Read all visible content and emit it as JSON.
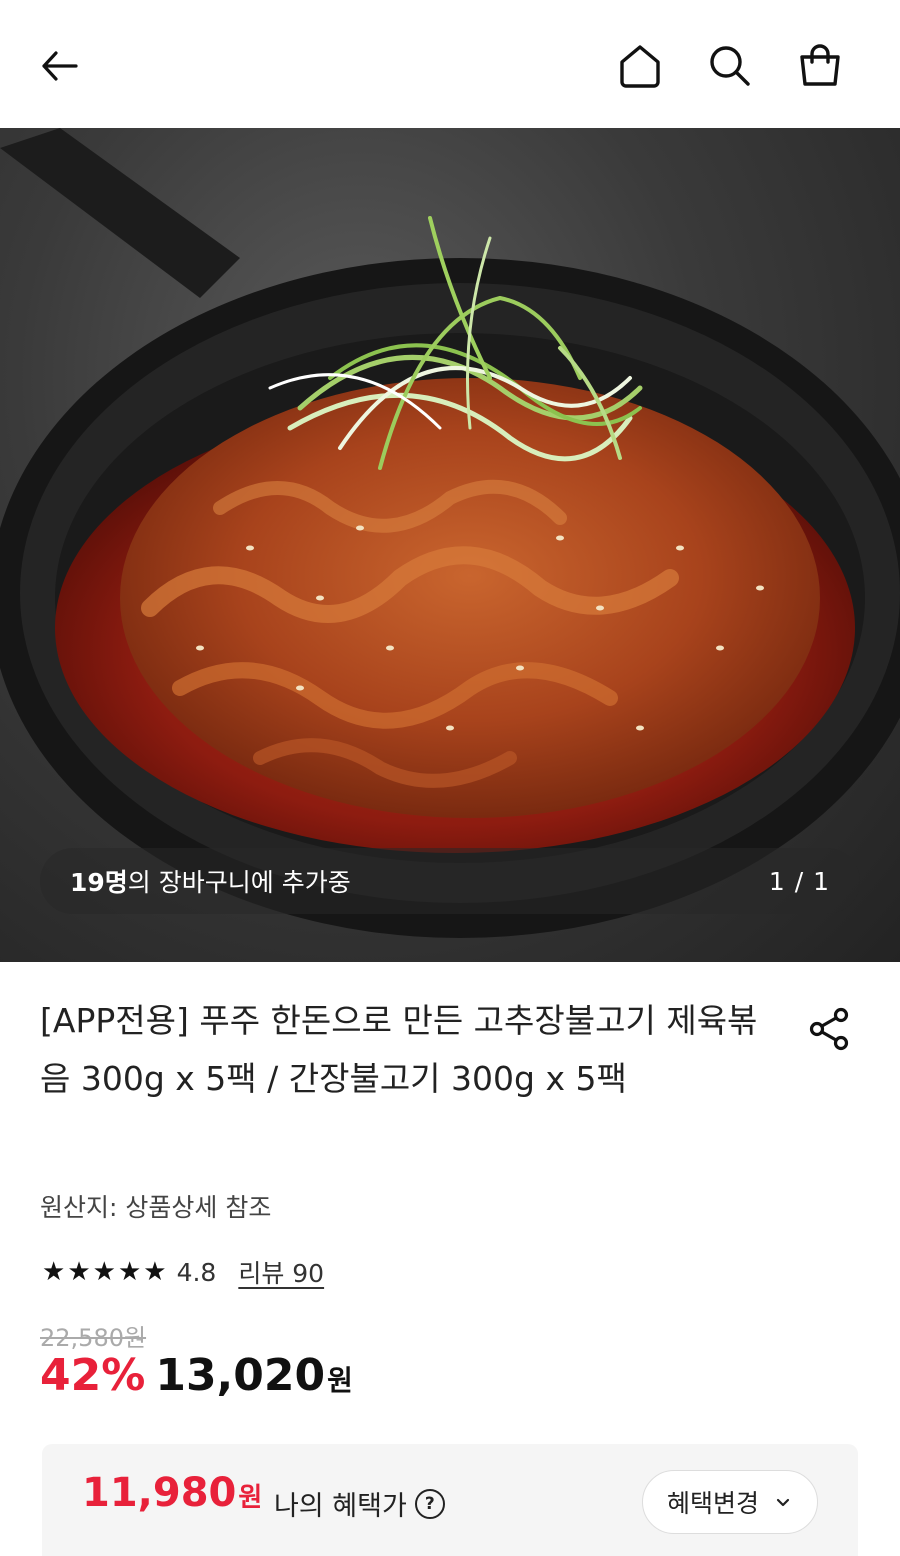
{
  "topbar": {
    "back_icon": "arrow-left-icon",
    "home_icon": "home-icon",
    "search_icon": "search-icon",
    "cart_icon": "shopping-bag-icon"
  },
  "hero": {
    "cart_count": "19명",
    "cart_text": "의 장바구니에 추가중",
    "image_counter": "1 / 1"
  },
  "product": {
    "title": "[APP전용] 푸주 한돈으로 만든 고추장불고기 제육볶음 300g x 5팩 / 간장불고기 300g x 5팩",
    "origin": "원산지: 상품상세 참조",
    "rating": {
      "stars": 5,
      "score": "4.8",
      "review_label": "리뷰 90"
    },
    "original_price": "22,580원",
    "discount": "42%",
    "price": "13,020",
    "price_unit": "원"
  },
  "benefit": {
    "price": "11,980",
    "price_unit": "원",
    "label": "나의 혜택가",
    "help_icon": "question-circle-icon",
    "change_label": "혜택변경",
    "accent_color": "#e8213a"
  }
}
